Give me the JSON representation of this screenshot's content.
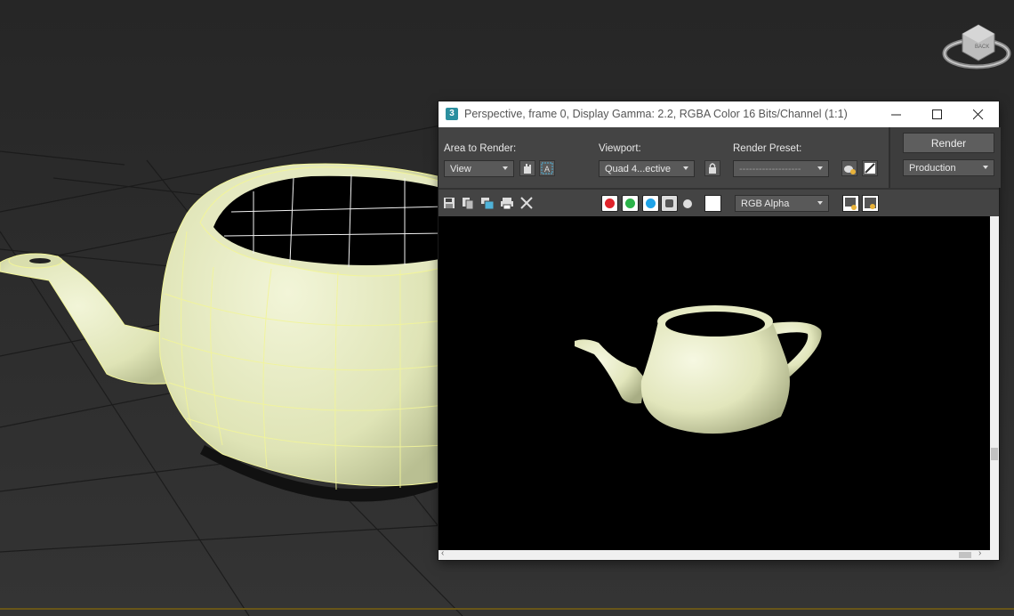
{
  "window": {
    "title": "Perspective, frame 0, Display Gamma: 2.2, RGBA Color 16 Bits/Channel (1:1)",
    "app_icon": "3"
  },
  "toolbar": {
    "area_label": "Area to Render:",
    "area_value": "View",
    "viewport_label": "Viewport:",
    "viewport_value": "Quad 4...ective",
    "preset_label": "Render Preset:",
    "preset_value": "-------------------",
    "render_label": "Render",
    "mode_value": "Production"
  },
  "toolbar2": {
    "channel_value": "RGB Alpha",
    "channels": [
      {
        "name": "red-channel",
        "color": "#e0242c"
      },
      {
        "name": "green-channel",
        "color": "#2cb34a"
      },
      {
        "name": "blue-channel",
        "color": "#1fa3e8"
      }
    ]
  },
  "colors": {
    "viewport_bg": "#2a2a2a",
    "teapot": "#e8edc6",
    "wire": "#f2f59a"
  }
}
